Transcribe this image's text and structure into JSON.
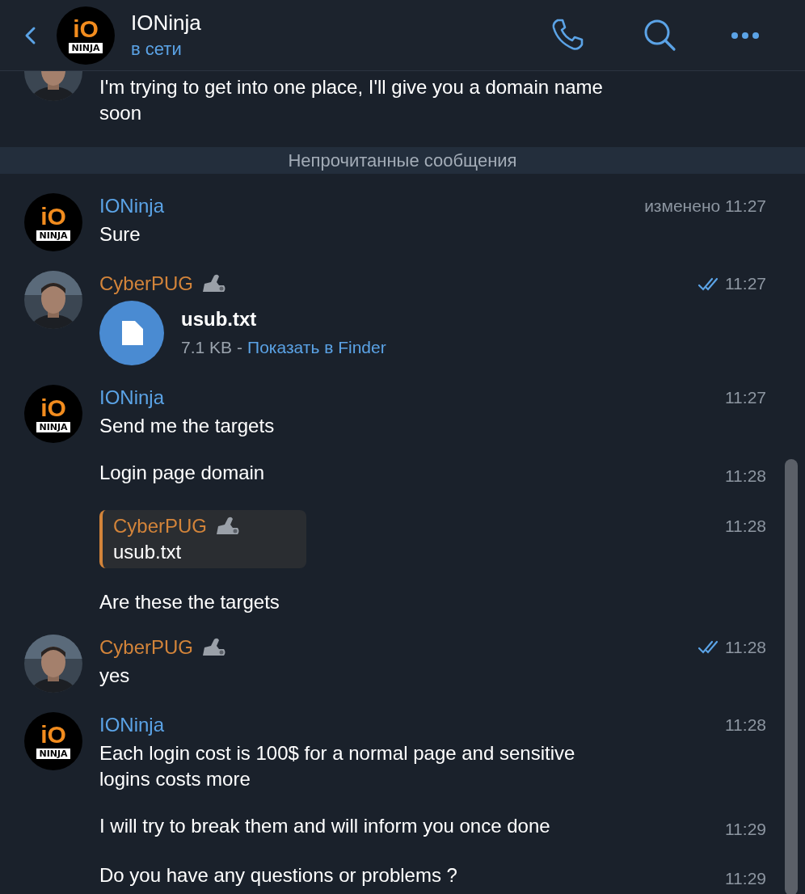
{
  "header": {
    "title": "IONinja",
    "status": "в сети",
    "avatar": {
      "kind": "logo",
      "top_text": "iO",
      "bottom_text": "NINJA"
    }
  },
  "unread_divider": "Непрочитанные сообщения",
  "groups": [
    {
      "partial": true,
      "avatar": {
        "kind": "person"
      },
      "messages": [
        {
          "kind": "text",
          "text": "I'm trying to get into one place, I'll give you a domain name soon"
        }
      ]
    },
    {
      "sender": {
        "name": "IONinja",
        "color": "#5ba3e6",
        "badge": false
      },
      "avatar": {
        "kind": "logo",
        "top_text": "iO",
        "bottom_text": "NINJA"
      },
      "time": "изменено 11:27",
      "read": false,
      "messages": [
        {
          "kind": "text",
          "text": "Sure"
        }
      ]
    },
    {
      "sender": {
        "name": "CyberPUG",
        "color": "#d3843a",
        "badge": true
      },
      "avatar": {
        "kind": "person"
      },
      "time": "11:27",
      "read": true,
      "messages": [
        {
          "kind": "file",
          "name": "usub.txt",
          "size": "7.1 KB",
          "separator": "-",
          "link": "Показать в Finder"
        }
      ]
    },
    {
      "sender": {
        "name": "IONinja",
        "color": "#5ba3e6",
        "badge": false
      },
      "avatar": {
        "kind": "logo",
        "top_text": "iO",
        "bottom_text": "NINJA"
      },
      "time": "11:27",
      "read": false,
      "messages": [
        {
          "kind": "text",
          "text": "Send me the targets"
        },
        {
          "kind": "text",
          "text": "Login page domain",
          "time": "11:28"
        },
        {
          "kind": "reply",
          "quote": {
            "name": "CyberPUG",
            "color": "#d3843a",
            "badge": true,
            "text": "usub.txt"
          },
          "time": "11:28"
        },
        {
          "kind": "text",
          "text": "Are these the targets"
        }
      ]
    },
    {
      "sender": {
        "name": "CyberPUG",
        "color": "#d3843a",
        "badge": true
      },
      "avatar": {
        "kind": "person"
      },
      "time": "11:28",
      "read": true,
      "messages": [
        {
          "kind": "text",
          "text": "yes"
        }
      ]
    },
    {
      "sender": {
        "name": "IONinja",
        "color": "#5ba3e6",
        "badge": false
      },
      "avatar": {
        "kind": "logo",
        "top_text": "iO",
        "bottom_text": "NINJA"
      },
      "time": "11:28",
      "read": false,
      "messages": [
        {
          "kind": "text",
          "text": "Each login cost is 100$ for a normal page and sensitive logins costs more"
        },
        {
          "kind": "text",
          "text": "I will try to break them and will inform you once done",
          "time": "11:29"
        },
        {
          "kind": "text",
          "text": "Do you have any questions or problems ?",
          "time": "11:29"
        }
      ]
    }
  ]
}
